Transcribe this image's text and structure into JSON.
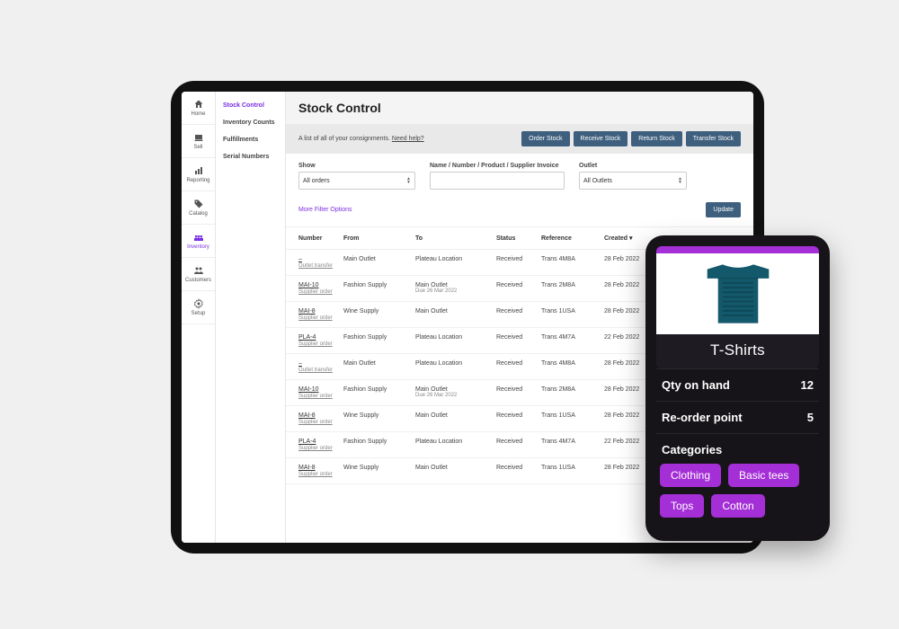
{
  "rail": [
    {
      "key": "home",
      "label": "Home"
    },
    {
      "key": "sell",
      "label": "Sell"
    },
    {
      "key": "reporting",
      "label": "Reporting"
    },
    {
      "key": "catalog",
      "label": "Catalog"
    },
    {
      "key": "inventory",
      "label": "Inventory"
    },
    {
      "key": "customers",
      "label": "Customers"
    },
    {
      "key": "setup",
      "label": "Setup"
    }
  ],
  "subnav": {
    "items": [
      "Stock Control",
      "Inventory Counts",
      "Fulfillments",
      "Serial Numbers"
    ],
    "active": 0
  },
  "page": {
    "title": "Stock Control",
    "description": "A list of all of your consignments.",
    "need_help": "Need help?"
  },
  "actions": {
    "order": "Order Stock",
    "receive": "Receive Stock",
    "return": "Return Stock",
    "transfer": "Transfer Stock",
    "update": "Update"
  },
  "filters": {
    "show_label": "Show",
    "show_value": "All orders",
    "name_label": "Name / Number / Product / Supplier Invoice",
    "name_value": "",
    "outlet_label": "Outlet",
    "outlet_value": "All Outlets",
    "more": "More Filter Options"
  },
  "table": {
    "headers": [
      "Number",
      "From",
      "To",
      "Status",
      "Reference",
      "Created ▾"
    ],
    "rows": [
      {
        "num": "–",
        "sub": "Outlet transfer",
        "from": "Main Outlet",
        "to": "Plateau Location",
        "to_sub": "",
        "status": "Received",
        "ref": "Trans 4M8A",
        "created": "28 Feb 2022"
      },
      {
        "num": "MAI-10",
        "sub": "Supplier order",
        "from": "Fashion Supply",
        "to": "Main Outlet",
        "to_sub": "Due 26 Mar 2022",
        "status": "Received",
        "ref": "Trans 2M8A",
        "created": "28 Feb 2022"
      },
      {
        "num": "MAI-8",
        "sub": "Supplier order",
        "from": "Wine Supply",
        "to": "Main Outlet",
        "to_sub": "",
        "status": "Received",
        "ref": "Trans 1USA",
        "created": "28 Feb 2022"
      },
      {
        "num": "PLA-4",
        "sub": "Supplier order",
        "from": "Fashion Supply",
        "to": "Plateau Location",
        "to_sub": "",
        "status": "Received",
        "ref": "Trans 4M7A",
        "created": "22 Feb 2022"
      },
      {
        "num": "–",
        "sub": "Outlet transfer",
        "from": "Main Outlet",
        "to": "Plateau Location",
        "to_sub": "",
        "status": "Received",
        "ref": "Trans 4M8A",
        "created": "28 Feb 2022"
      },
      {
        "num": "MAI-10",
        "sub": "Supplier order",
        "from": "Fashion Supply",
        "to": "Main Outlet",
        "to_sub": "Due 26 Mar 2022",
        "status": "Received",
        "ref": "Trans 2M8A",
        "created": "28 Feb 2022"
      },
      {
        "num": "MAI-8",
        "sub": "Supplier order",
        "from": "Wine Supply",
        "to": "Main Outlet",
        "to_sub": "",
        "status": "Received",
        "ref": "Trans 1USA",
        "created": "28 Feb 2022"
      },
      {
        "num": "PLA-4",
        "sub": "Supplier order",
        "from": "Fashion Supply",
        "to": "Plateau Location",
        "to_sub": "",
        "status": "Received",
        "ref": "Trans 4M7A",
        "created": "22 Feb 2022"
      },
      {
        "num": "MAI-8",
        "sub": "Supplier order",
        "from": "Wine Supply",
        "to": "Main Outlet",
        "to_sub": "",
        "status": "Received",
        "ref": "Trans 1USA",
        "created": "28 Feb 2022"
      }
    ]
  },
  "phone": {
    "title": "T-Shirts",
    "qty_label": "Qty on hand",
    "qty_value": "12",
    "reorder_label": "Re-order point",
    "reorder_value": "5",
    "categories_label": "Categories",
    "tags": [
      "Clothing",
      "Basic tees",
      "Tops",
      "Cotton"
    ]
  }
}
